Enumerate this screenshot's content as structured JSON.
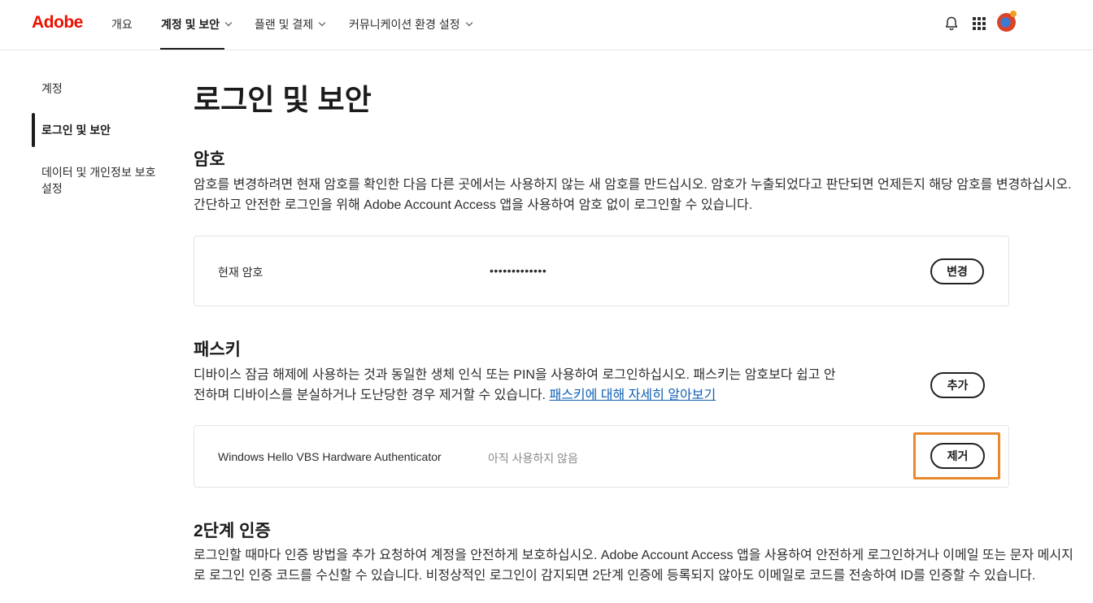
{
  "brand": {
    "logo_text": "Adobe",
    "accent": "#eb1000"
  },
  "nav": {
    "items": [
      {
        "label": "개요"
      },
      {
        "label": "계정 및 보안",
        "active": true
      },
      {
        "label": "플랜 및 결제"
      },
      {
        "label": "커뮤니케이션 환경 설정"
      }
    ],
    "icons": [
      "bell-icon",
      "apps-grid-icon",
      "avatar"
    ]
  },
  "sidebar": {
    "items": [
      {
        "label": "계정"
      },
      {
        "label": "로그인 및 보안",
        "active": true
      },
      {
        "label": "데이터 및 개인정보 보호 설정"
      }
    ]
  },
  "main": {
    "title": "로그인 및 보안",
    "password": {
      "heading": "암호",
      "description_line1": "암호를 변경하려면 현재 암호를 확인한 다음 다른 곳에서는 사용하지 않는 새 암호를 만드십시오. 암호가 누출되었다고 판단되면 언제든지 해당 암호를 변경하십시오.",
      "description_line2": "간단하고 안전한 로그인을 위해 Adobe Account Access 앱을 사용하여 암호 없이 로그인할 수 있습니다.",
      "current_label": "현재 암호",
      "current_value": "•••••••••••••",
      "change_button": "변경"
    },
    "passkey": {
      "heading": "패스키",
      "description_line1": "디바이스 잠금 해제에 사용하는 것과 동일한 생체 인식 또는 PIN을 사용하여 로그인하십시오. 패스키는 암호보다 쉽고 안",
      "description_line2": "전하며 디바이스를 분실하거나 도난당한 경우 제거할 수 있습니다.",
      "learn_more_link": "패스키에 대해 자세히 알아보기",
      "add_button": "추가",
      "device_name": "Windows Hello VBS Hardware Authenticator",
      "device_status": "아직 사용하지 않음",
      "remove_button": "제거"
    },
    "two_factor": {
      "heading": "2단계 인증",
      "description_line1": "로그인할 때마다 인증 방법을 추가 요청하여 계정을 안전하게 보호하십시오. Adobe Account Access 앱을 사용하여 안전하게 로그인하거나 이메일 또는 문자 메시지",
      "description_line2": "로 로그인 인증 코드를 수신할 수 있습니다. 비정상적인 로그인이 감지되면 2단계 인증에 등록되지 않아도 이메일로 코드를 전송하여 ID를 인증할 수 있습니다."
    }
  },
  "colors": {
    "highlight": "#e8892b",
    "link": "#0f5fb5"
  }
}
